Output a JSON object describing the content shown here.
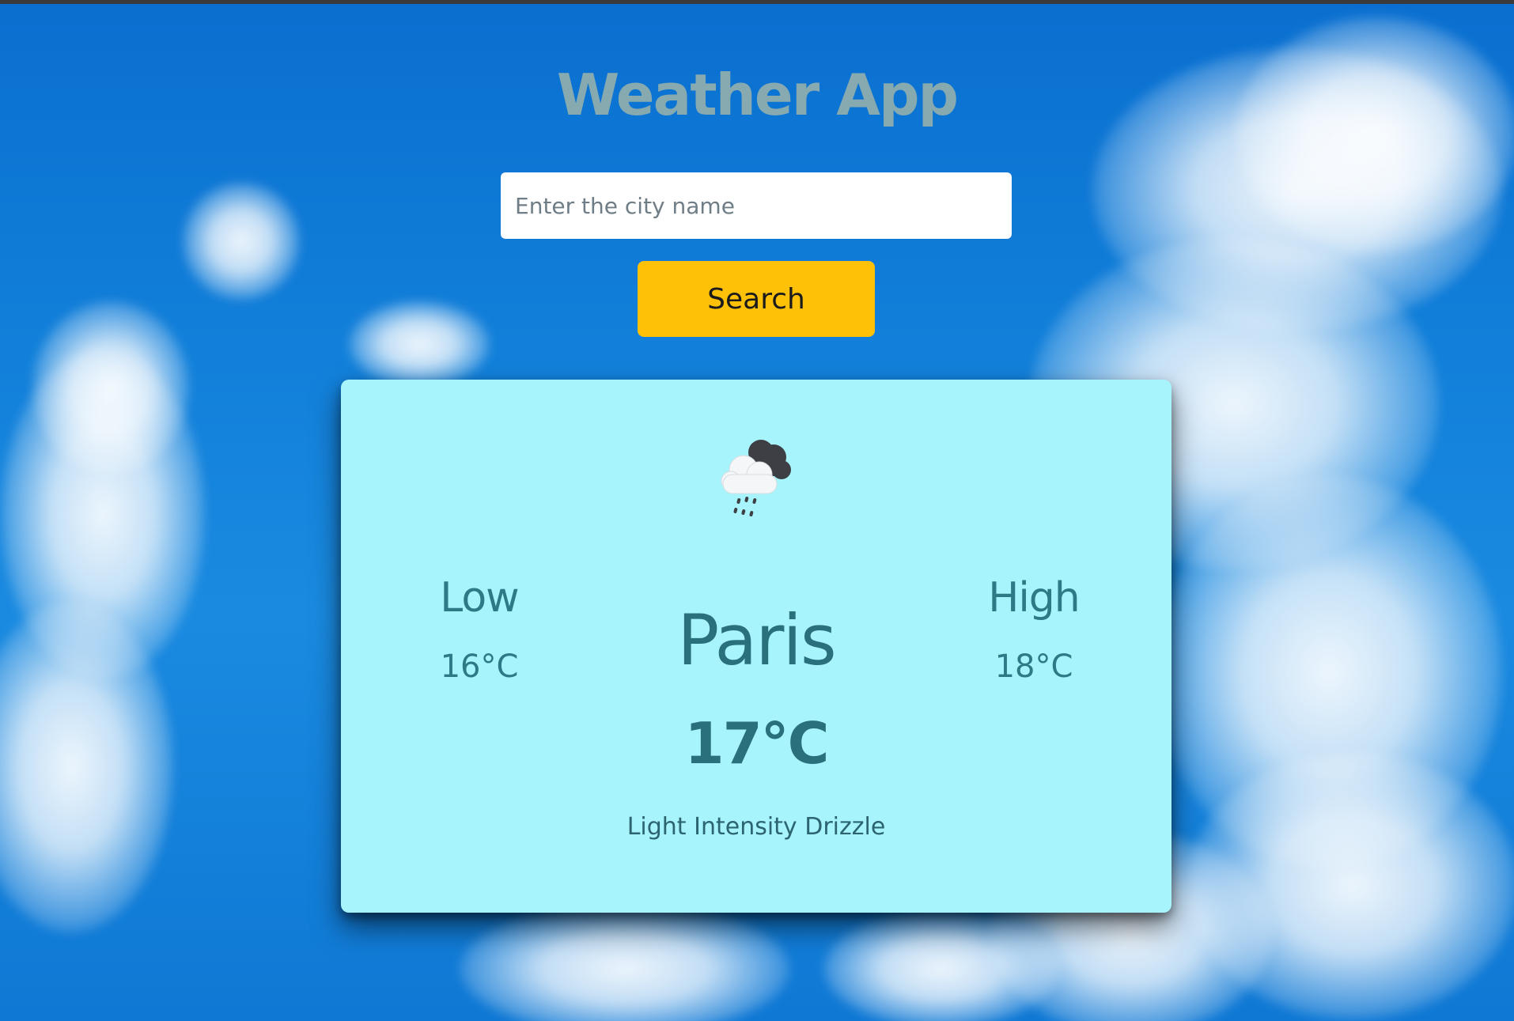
{
  "app": {
    "title": "Weather App"
  },
  "search": {
    "placeholder": "Enter the city name",
    "value": "",
    "button_label": "Search"
  },
  "weather": {
    "icon": "rain-cloud-icon",
    "city": "Paris",
    "temperature": "17°C",
    "description": "Light Intensity Drizzle",
    "low_label": "Low",
    "low_temp": "16°C",
    "high_label": "High",
    "high_temp": "18°C"
  },
  "colors": {
    "sky_background": "#1280da",
    "title": "#86aab0",
    "button": "#fec107",
    "card": "#a7f4fc",
    "card_text": "#2a6f7c"
  }
}
